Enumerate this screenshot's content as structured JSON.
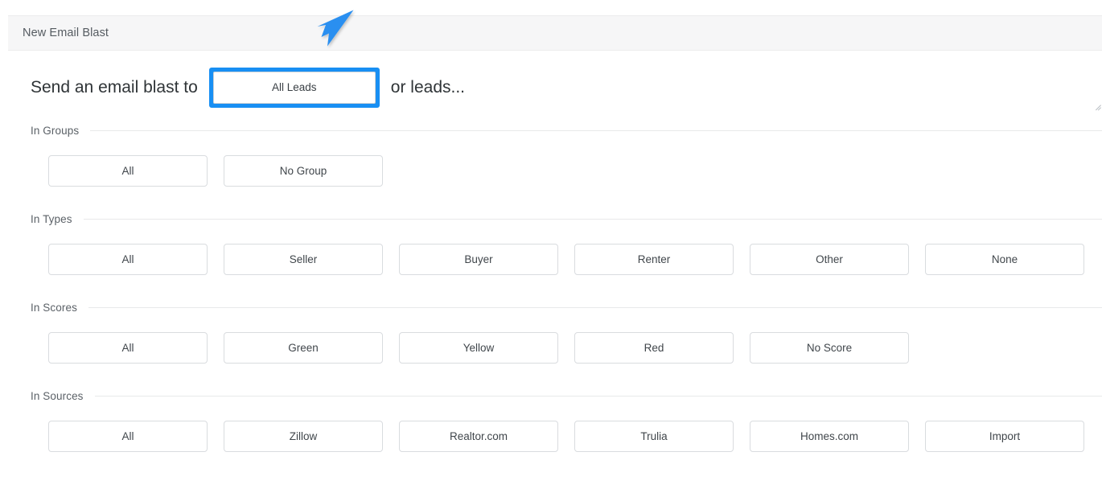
{
  "header": {
    "title": "New Email Blast"
  },
  "send_row": {
    "lead_in": "Send an email blast to",
    "recipient_value": "All Leads",
    "recipient_placeholder": "All Leads",
    "trailing": "or leads..."
  },
  "annotation": {
    "arrow_color": "#2a8ff0",
    "highlight_color": "#188ff3"
  },
  "sections": [
    {
      "label": "In Groups",
      "chips": [
        "All",
        "No Group"
      ]
    },
    {
      "label": "In Types",
      "chips": [
        "All",
        "Seller",
        "Buyer",
        "Renter",
        "Other",
        "None"
      ]
    },
    {
      "label": "In Scores",
      "chips": [
        "All",
        "Green",
        "Yellow",
        "Red",
        "No Score"
      ]
    },
    {
      "label": "In Sources",
      "chips": [
        "All",
        "Zillow",
        "Realtor.com",
        "Trulia",
        "Homes.com",
        "Import"
      ]
    }
  ]
}
